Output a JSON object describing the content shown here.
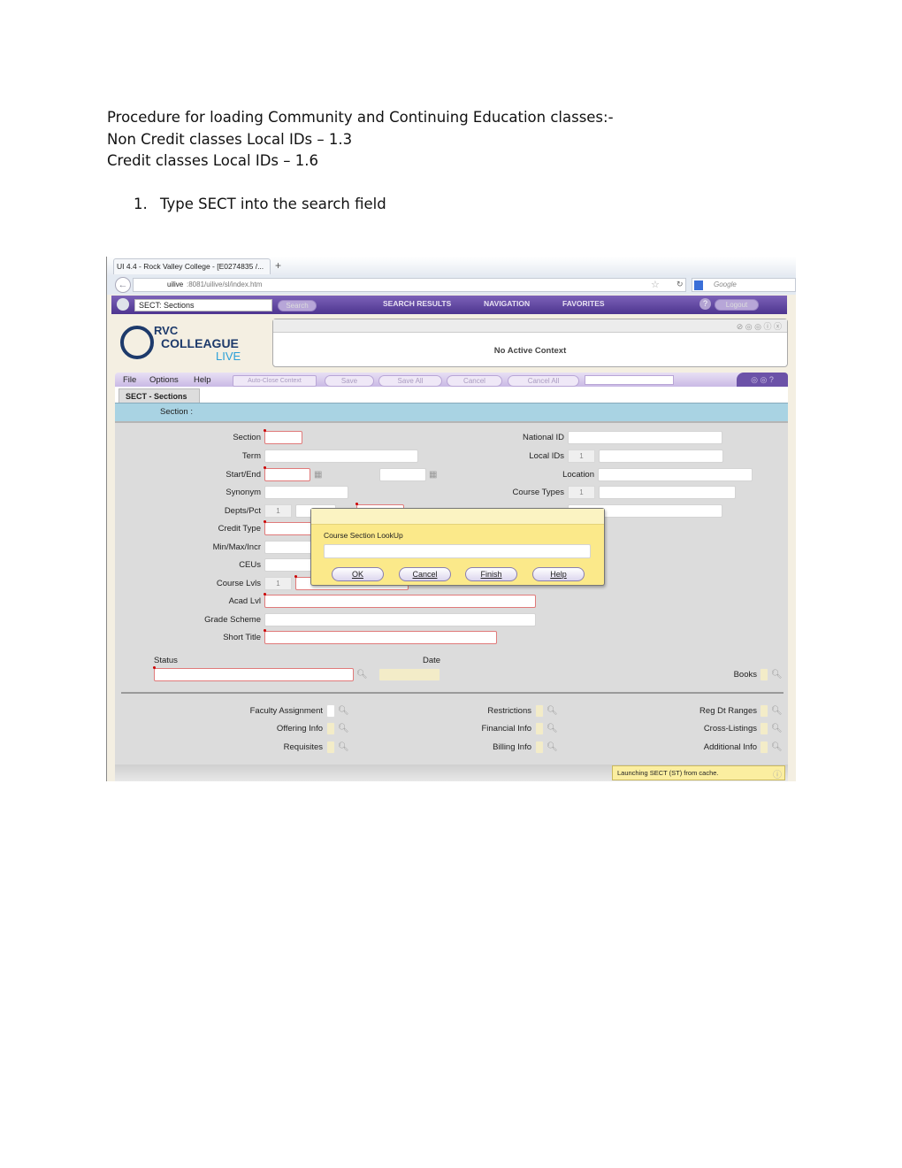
{
  "document": {
    "heading_lines": [
      "Procedure for loading Community and Continuing Education classes:-",
      "Non Credit classes Local IDs – 1.3",
      "Credit classes Local IDs – 1.6"
    ],
    "step_number": "1.",
    "step_text": "Type SECT into the search field"
  },
  "browser": {
    "tab_title": "UI 4.4 - Rock Valley College - [E0274835 /...",
    "new_tab": "+",
    "url_host": "uilive",
    "url_path": ":8081/uilive/sl/index.htm",
    "search_engine": "Google"
  },
  "app": {
    "search_value": "SECT: Sections",
    "search_button": "Search",
    "nav": [
      "SEARCH RESULTS",
      "NAVIGATION",
      "FAVORITES"
    ],
    "help": "?",
    "logout": "Logout",
    "logo": {
      "line1": "RVC",
      "line2": "COLLEAGUE",
      "line3": "LIVE"
    },
    "context_text": "No Active Context",
    "menu": [
      "File",
      "Options",
      "Help"
    ],
    "auto_close": "Auto-Close Context",
    "toolbar": [
      "Save",
      "Save All",
      "Cancel",
      "Cancel All"
    ],
    "form_tab": "SECT - Sections",
    "band_label": "Section :",
    "left_fields": [
      {
        "label": "Section"
      },
      {
        "label": "Term"
      },
      {
        "label": "Start/End"
      },
      {
        "label": "Synonym"
      },
      {
        "label": "Depts/Pct",
        "count": "1"
      },
      {
        "label": "Credit Type"
      },
      {
        "label": "Min/Max/Incr"
      },
      {
        "label": "CEUs"
      },
      {
        "label": "Course Lvls",
        "count": "1"
      },
      {
        "label": "Acad Lvl"
      },
      {
        "label": "Grade Scheme"
      },
      {
        "label": "Short Title"
      }
    ],
    "right_fields": [
      {
        "label": "National ID"
      },
      {
        "label": "Local IDs",
        "count": "1"
      },
      {
        "label": "Location"
      },
      {
        "label": "Course Types",
        "count": "1"
      }
    ],
    "status_label": "Status",
    "date_label": "Date",
    "books_label": "Books",
    "links": [
      [
        "Faculty Assignment",
        "Offering Info",
        "Requisites"
      ],
      [
        "Restrictions",
        "Financial Info",
        "Billing Info"
      ],
      [
        "Reg Dt Ranges",
        "Cross-Listings",
        "Additional Info"
      ]
    ],
    "status_message": "Launching SECT (ST) from cache."
  },
  "dialog": {
    "title": "Course Section LookUp",
    "input_value": "",
    "buttons": [
      "OK",
      "Cancel",
      "Finish",
      "Help"
    ]
  },
  "colors": {
    "purple": "#5b3f9a",
    "band": "#a9d3e3",
    "form_bg": "#dcdcdc",
    "dialog": "#fbe98a"
  }
}
